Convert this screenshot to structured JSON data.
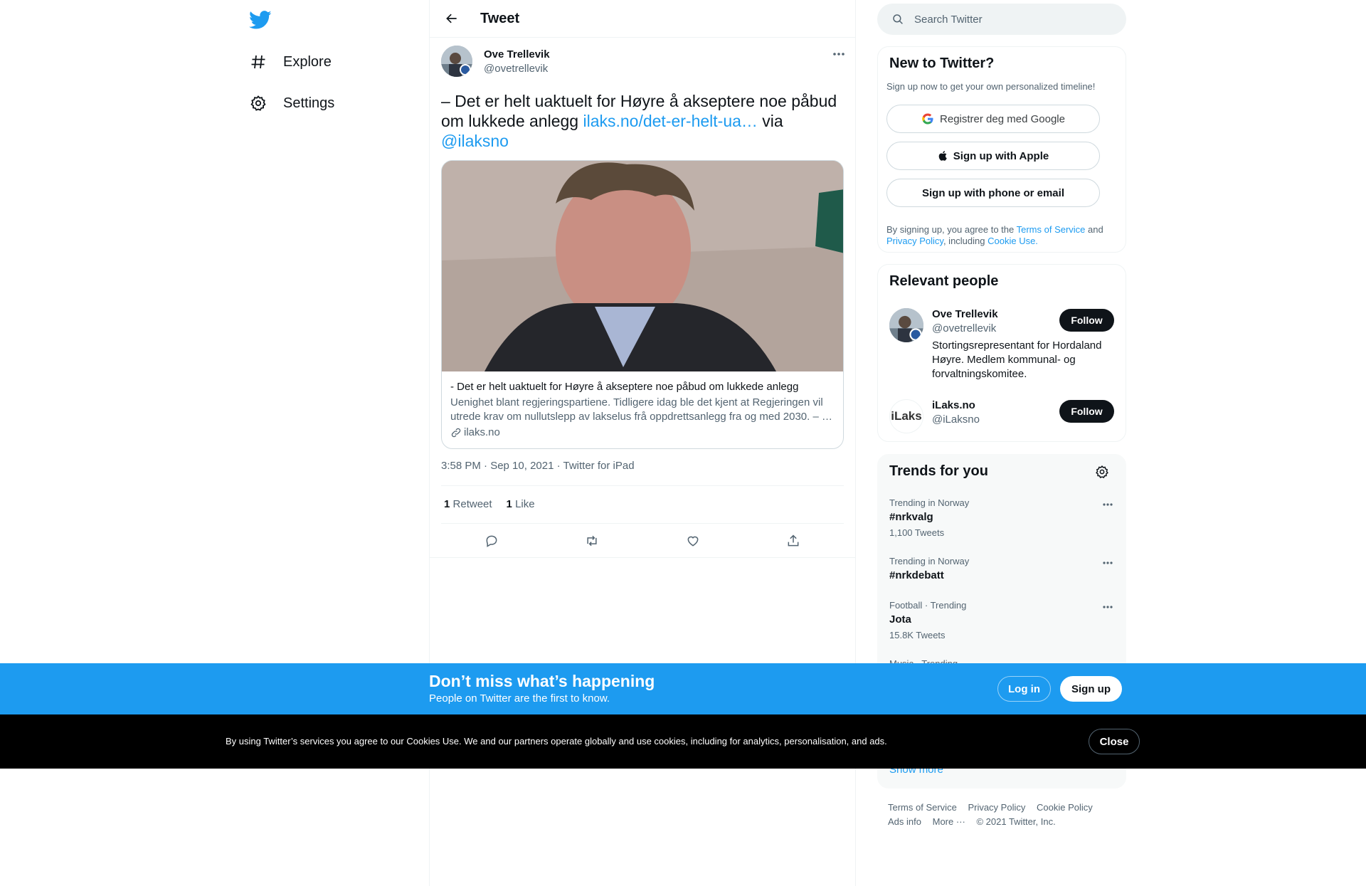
{
  "nav": {
    "items": [
      {
        "label": "Explore",
        "icon": "hashtag-icon"
      },
      {
        "label": "Settings",
        "icon": "gear-icon"
      }
    ]
  },
  "header": {
    "title": "Tweet"
  },
  "tweet": {
    "author_name": "Ove Trellevik",
    "author_handle": "@ovetrellevik",
    "text_pre": "– Det er helt uaktuelt for Høyre å akseptere noe påbud om lukkede anlegg ",
    "link_text": "ilaks.no/det-er-helt-ua…",
    "text_via": " via ",
    "mention": "@ilaksno",
    "card": {
      "title": "- Det er helt uaktuelt for Høyre å akseptere noe påbud om lukkede anlegg",
      "description": "Uenighet blant regjeringspartiene. Tidligere idag ble det kjent at Regjeringen vil utrede krav om nullutslepp av lakselus frå oppdrettsanlegg fra og med 2030. – …",
      "domain": "ilaks.no"
    },
    "meta": "3:58 PM · Sep 10, 2021 · Twitter for iPad",
    "retweets_count": "1",
    "retweets_label": "Retweet",
    "likes_count": "1",
    "likes_label": "Like"
  },
  "search": {
    "placeholder": "Search Twitter"
  },
  "new_to_twitter": {
    "title": "New to Twitter?",
    "subtitle": "Sign up now to get your own personalized timeline!",
    "google_btn": "Registrer deg med Google",
    "apple_btn": "Sign up with Apple",
    "email_btn": "Sign up with phone or email",
    "legal_pre": "By signing up, you agree to the ",
    "terms": "Terms of Service",
    "legal_and": " and ",
    "privacy": "Privacy Policy",
    "legal_including": ", including ",
    "cookie": "Cookie Use."
  },
  "relevant_people": {
    "title": "Relevant people",
    "people": [
      {
        "name": "Ove Trellevik",
        "handle": "@ovetrellevik",
        "bio": "Stortingsrepresentant for Hordaland Høyre. Medlem kommunal- og forvaltningskomitee.",
        "follow": "Follow"
      },
      {
        "name": "iLaks.no",
        "handle": "@iLaksno",
        "bio": "",
        "follow": "Follow",
        "avatar_text": "iLaks"
      }
    ]
  },
  "trends": {
    "title": "Trends for you",
    "items": [
      {
        "context": "Trending in Norway",
        "name": "#nrkvalg",
        "count": "1,100 Tweets"
      },
      {
        "context": "Trending in Norway",
        "name": "#nrkdebatt",
        "count": ""
      },
      {
        "context": "Football · Trending",
        "name": "Jota",
        "count": "15.8K Tweets"
      },
      {
        "context": "Music · Trending",
        "name": "",
        "count": ""
      }
    ],
    "show_more": "Show more"
  },
  "footer": {
    "links": [
      "Terms of Service",
      "Privacy Policy",
      "Cookie Policy"
    ],
    "links2": [
      "Ads info",
      "More ···",
      "© 2021 Twitter, Inc."
    ]
  },
  "bottom_bar": {
    "title": "Don’t miss what’s happening",
    "subtitle": "People on Twitter are the first to know.",
    "login": "Log in",
    "signup": "Sign up"
  },
  "cookie_bar": {
    "text": "By using Twitter’s services you agree to our Cookies Use. We and our partners operate globally and use cookies, including for analytics, personalisation, and ads.",
    "close": "Close"
  },
  "colors": {
    "accent": "#1d9bf0",
    "text": "#0f1419",
    "secondary": "#536471",
    "border": "#eff3f4"
  }
}
